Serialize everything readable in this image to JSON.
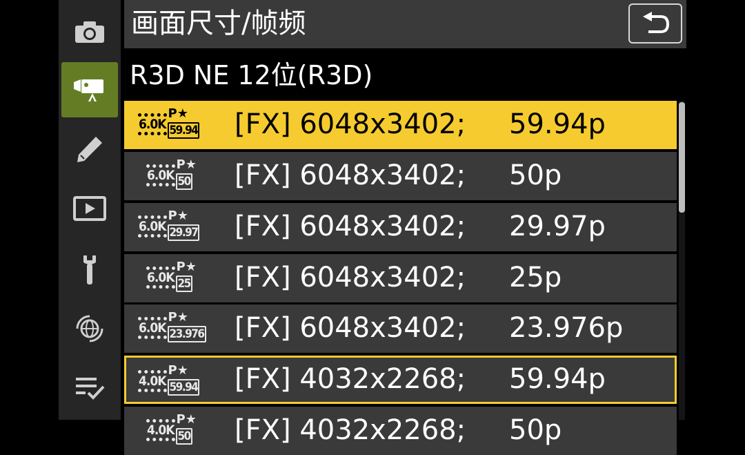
{
  "window": {
    "title": "画面尺寸/帧频",
    "subtitle": "R3D NE 12位(R3D)"
  },
  "sidebar": {
    "items": [
      {
        "icon": "camera-icon",
        "active": false
      },
      {
        "icon": "movie-camera-icon",
        "active": true
      },
      {
        "icon": "pencil-icon",
        "active": false
      },
      {
        "icon": "playback-icon",
        "active": false
      },
      {
        "icon": "wrench-icon",
        "active": false
      },
      {
        "icon": "network-icon",
        "active": false
      },
      {
        "icon": "checklist-icon",
        "active": false
      }
    ]
  },
  "back_button": {
    "icon": "return-arrow-icon"
  },
  "options": [
    {
      "res": "6.0K",
      "pstar": "P★",
      "fps": "59.94",
      "format": "[FX] 6048x3402;",
      "rate": "59.94p",
      "state": "highlighted"
    },
    {
      "res": "6.0K",
      "pstar": "P★",
      "fps": "50",
      "format": "[FX] 6048x3402;",
      "rate": "50p",
      "state": "normal"
    },
    {
      "res": "6.0K",
      "pstar": "P★",
      "fps": "29.97",
      "format": "[FX] 6048x3402;",
      "rate": "29.97p",
      "state": "normal"
    },
    {
      "res": "6.0K",
      "pstar": "P★",
      "fps": "25",
      "format": "[FX] 6048x3402;",
      "rate": "25p",
      "state": "normal"
    },
    {
      "res": "6.0K",
      "pstar": "P★",
      "fps": "23.976",
      "format": "[FX] 6048x3402;",
      "rate": "23.976p",
      "state": "normal"
    },
    {
      "res": "4.0K",
      "pstar": "P★",
      "fps": "59.94",
      "format": "[FX] 4032x2268;",
      "rate": "59.94p",
      "state": "current"
    },
    {
      "res": "4.0K",
      "pstar": "P★",
      "fps": "50",
      "format": "[FX] 4032x2268;",
      "rate": "50p",
      "state": "partially-visible"
    }
  ],
  "colors": {
    "highlight": "#f5cb2f",
    "active_tab": "#647d24",
    "row_bg": "#3a3a3a",
    "rail_bg": "#262626"
  }
}
